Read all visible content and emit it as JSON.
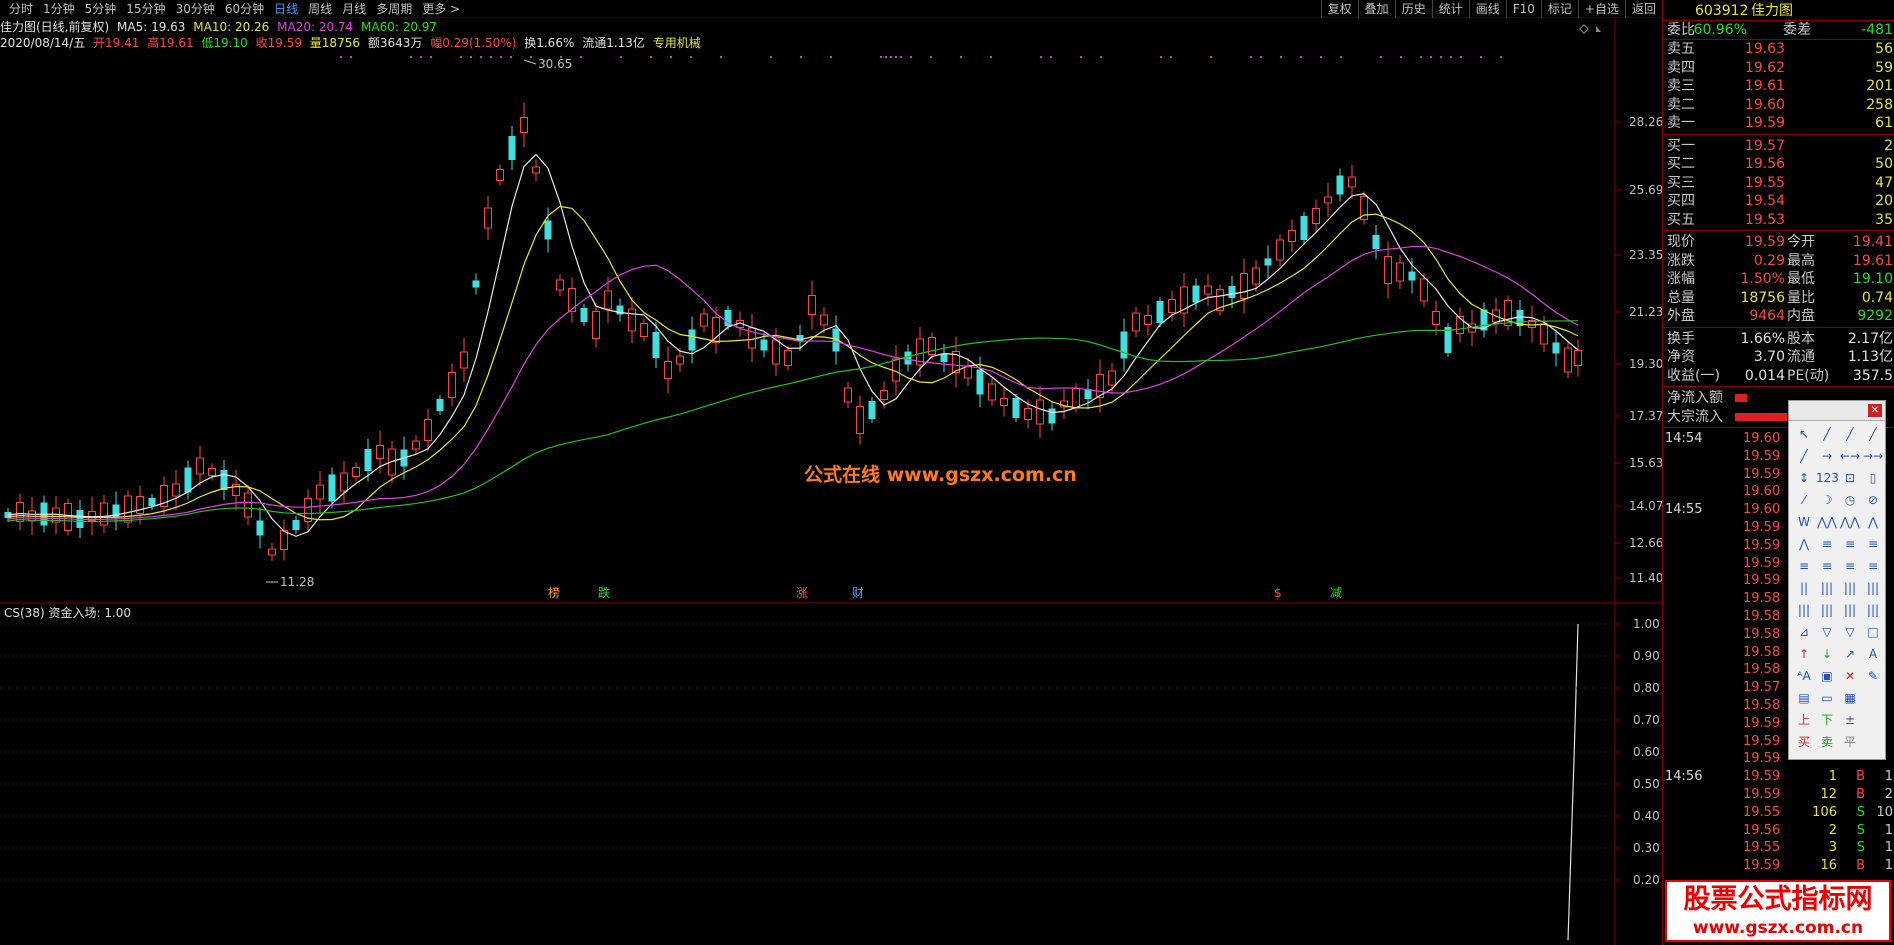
{
  "toolbar": {
    "periods": [
      "分时",
      "1分钟",
      "5分钟",
      "15分钟",
      "30分钟",
      "60分钟",
      "日线",
      "周线",
      "月线",
      "多周期",
      "更多"
    ],
    "active_period": "日线",
    "right_tools": [
      "复权",
      "叠加",
      "历史",
      "统计",
      "画线",
      "F10",
      "标记",
      "+自选",
      "返回"
    ]
  },
  "info": {
    "title": "佳力图(日线,前复权)",
    "ma5": "MA5: 19.63",
    "ma10": "MA10: 20.26",
    "ma20": "MA20: 20.74",
    "ma60": "MA60: 20.97",
    "date": "2020/08/14/五",
    "open": "开19.41",
    "high": "高19.61",
    "low": "低19.10",
    "close": "收19.59",
    "volume": "量18756",
    "amount": "额3643万",
    "change": "幅0.29(1.50%)",
    "turnover": "换1.66%",
    "float": "流通1.13亿",
    "concept": "专用机械"
  },
  "price_axis": [
    "28.26",
    "25.69",
    "23.35",
    "21.23",
    "19.30",
    "17.37",
    "15.63",
    "14.07",
    "12.66",
    "11.40"
  ],
  "peak_label": "30.65",
  "trough_label": "11.28",
  "event_markers": [
    {
      "text": "榜",
      "color": "#ff9a3a"
    },
    {
      "text": "跌",
      "color": "#22e022"
    },
    {
      "text": "涨",
      "color": "#ff4545"
    },
    {
      "text": "财",
      "color": "#4aa0ff"
    },
    {
      "text": "$",
      "color": "#ff4545"
    },
    {
      "text": "减",
      "color": "#22e022"
    }
  ],
  "indicator": {
    "label": "CS(38)",
    "value": "资金入场: 1.00",
    "axis": [
      "1.00",
      "0.90",
      "0.80",
      "0.70",
      "0.60",
      "0.50",
      "0.40",
      "0.30",
      "0.20"
    ]
  },
  "watermark": "公式在线  www.gszx.com.cn",
  "logo_watermark": {
    "line1": "股票公式指标网",
    "line2": "www.gszx.com.cn"
  },
  "quote": {
    "code": "603912",
    "name": "佳力图",
    "weibi_label": "委比",
    "weibi": "-60.96%",
    "weicha_label": "委差",
    "weicha": "-481",
    "asks": [
      {
        "label": "卖五",
        "price": "19.63",
        "vol": "56"
      },
      {
        "label": "卖四",
        "price": "19.62",
        "vol": "59"
      },
      {
        "label": "卖三",
        "price": "19.61",
        "vol": "201"
      },
      {
        "label": "卖二",
        "price": "19.60",
        "vol": "258"
      },
      {
        "label": "卖一",
        "price": "19.59",
        "vol": "61"
      }
    ],
    "bids": [
      {
        "label": "买一",
        "price": "19.57",
        "vol": "2"
      },
      {
        "label": "买二",
        "price": "19.56",
        "vol": "50"
      },
      {
        "label": "买三",
        "price": "19.55",
        "vol": "47"
      },
      {
        "label": "买四",
        "price": "19.54",
        "vol": "20"
      },
      {
        "label": "买五",
        "price": "19.53",
        "vol": "35"
      }
    ],
    "stats": [
      {
        "l1": "现价",
        "v1": "19.59",
        "c1": "#ff4545",
        "l2": "今开",
        "v2": "19.41",
        "c2": "#ff4545"
      },
      {
        "l1": "涨跌",
        "v1": "0.29",
        "c1": "#ff4545",
        "l2": "最高",
        "v2": "19.61",
        "c2": "#ff4545"
      },
      {
        "l1": "涨幅",
        "v1": "1.50%",
        "c1": "#ff4545",
        "l2": "最低",
        "v2": "19.10",
        "c2": "#22e022"
      },
      {
        "l1": "总量",
        "v1": "18756",
        "c1": "#e8e82a",
        "l2": "量比",
        "v2": "0.74",
        "c2": "#e8e82a"
      },
      {
        "l1": "外盘",
        "v1": "9464",
        "c1": "#ff4545",
        "l2": "内盘",
        "v2": "9292",
        "c2": "#22e022"
      }
    ],
    "stats2": [
      {
        "l1": "换手",
        "v1": "1.66%",
        "l2": "股本",
        "v2": "2.17亿"
      },
      {
        "l1": "净资",
        "v1": "3.70",
        "l2": "流通",
        "v2": "1.13亿"
      },
      {
        "l1": "收益(一)",
        "v1": "0.014",
        "l2": "PE(动)",
        "v2": "357.5"
      }
    ],
    "flow": [
      {
        "label": "净流入额"
      },
      {
        "label": "大宗流入"
      }
    ]
  },
  "ticks": [
    {
      "time": "14:54",
      "price": "19.60",
      "vol": "",
      "side": "",
      "side_color": "",
      "num": ""
    },
    {
      "time": "",
      "price": "19.59",
      "vol": "",
      "side": "",
      "side_color": "",
      "num": ""
    },
    {
      "time": "",
      "price": "19.59",
      "vol": "",
      "side": "",
      "side_color": "",
      "num": ""
    },
    {
      "time": "",
      "price": "19.60",
      "vol": "",
      "side": "",
      "side_color": "",
      "num": ""
    },
    {
      "time": "14:55",
      "price": "19.60",
      "vol": "",
      "side": "",
      "side_color": "",
      "num": ""
    },
    {
      "time": "",
      "price": "19.59",
      "vol": "",
      "side": "",
      "side_color": "",
      "num": ""
    },
    {
      "time": "",
      "price": "19.59",
      "vol": "",
      "side": "",
      "side_color": "",
      "num": ""
    },
    {
      "time": "",
      "price": "19.59",
      "vol": "",
      "side": "",
      "side_color": "",
      "num": ""
    },
    {
      "time": "",
      "price": "19.59",
      "vol": "",
      "side": "",
      "side_color": "",
      "num": ""
    },
    {
      "time": "",
      "price": "19.58",
      "vol": "",
      "side": "",
      "side_color": "",
      "num": ""
    },
    {
      "time": "",
      "price": "19.58",
      "vol": "",
      "side": "",
      "side_color": "",
      "num": ""
    },
    {
      "time": "",
      "price": "19.58",
      "vol": "",
      "side": "",
      "side_color": "",
      "num": ""
    },
    {
      "time": "",
      "price": "19.58",
      "vol": "",
      "side": "",
      "side_color": "",
      "num": ""
    },
    {
      "time": "",
      "price": "19.58",
      "vol": "",
      "side": "",
      "side_color": "",
      "num": ""
    },
    {
      "time": "",
      "price": "19.57",
      "vol": "",
      "side": "",
      "side_color": "",
      "num": ""
    },
    {
      "time": "",
      "price": "19.58",
      "vol": "",
      "side": "",
      "side_color": "",
      "num": ""
    },
    {
      "time": "",
      "price": "19.59",
      "vol": "",
      "side": "",
      "side_color": "",
      "num": ""
    },
    {
      "time": "",
      "price": "19.59",
      "vol": "",
      "side": "",
      "side_color": "",
      "num": ""
    },
    {
      "time": "",
      "price": "19.59",
      "vol": "",
      "side": "",
      "side_color": "",
      "num": ""
    },
    {
      "time": "14:56",
      "price": "19.59",
      "vol": "1",
      "side": "B",
      "side_color": "#ff4545",
      "num": "1"
    },
    {
      "time": "",
      "price": "19.59",
      "vol": "12",
      "side": "B",
      "side_color": "#ff4545",
      "num": "2"
    },
    {
      "time": "",
      "price": "19.55",
      "vol": "106",
      "side": "S",
      "side_color": "#22e022",
      "num": "10"
    },
    {
      "time": "",
      "price": "19.56",
      "vol": "2",
      "side": "S",
      "side_color": "#22e022",
      "num": "1"
    },
    {
      "time": "",
      "price": "19.55",
      "vol": "3",
      "side": "S",
      "side_color": "#22e022",
      "num": "1"
    },
    {
      "time": "",
      "price": "19.59",
      "vol": "16",
      "side": "B",
      "side_color": "#ff4545",
      "num": "1"
    }
  ],
  "draw_tools": [
    "↖",
    "╱",
    "╱",
    "╱",
    "╱",
    "→",
    "←→",
    "→→",
    "↕",
    "123",
    "⊡",
    "▯",
    "⁄",
    "☽",
    "◷",
    "⊘",
    "W",
    "⋀⋀",
    "⋀⋀",
    "⋀",
    "⋀",
    "≡",
    "≡",
    "≡",
    "≡",
    "≡",
    "≡",
    "≡",
    "||",
    "|||",
    "|||",
    "|||",
    "|||",
    "|||",
    "|||",
    "|||",
    "⊿",
    "▽",
    "▽",
    "□",
    "↑",
    "↓",
    "↗",
    "A",
    "ᴬA",
    "▣",
    "✕",
    "✎",
    "▤",
    "▭",
    "▦",
    "",
    "上",
    "下",
    "±",
    "",
    "买",
    "卖",
    "平",
    ""
  ],
  "colors": {
    "up": "#ff4545",
    "down": "#40e0e0",
    "ma5": "#e8e8e8",
    "ma10": "#e8e82a",
    "ma20": "#e040e0",
    "ma60": "#22c022",
    "frame": "#880000"
  }
}
